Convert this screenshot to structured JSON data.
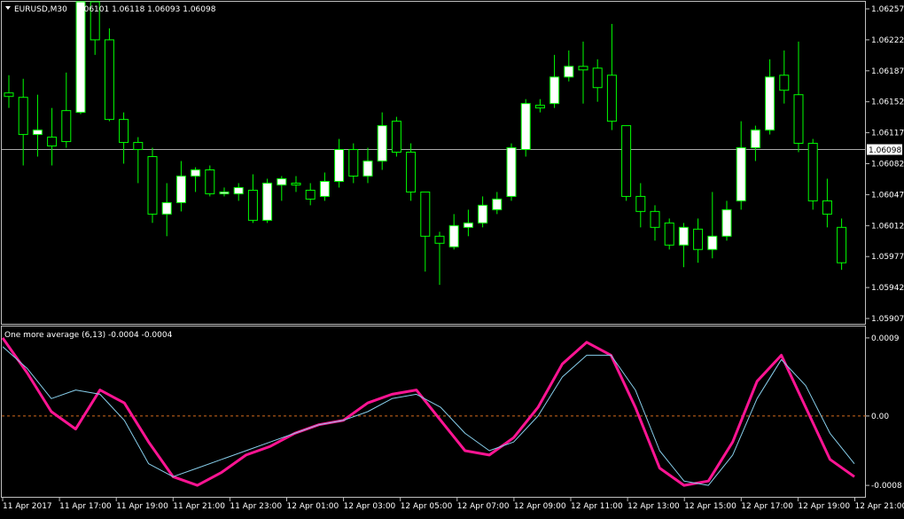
{
  "header": {
    "symbol": "EURUSD,M30",
    "ohlc": "1.06101 1.06118 1.06093 1.06098",
    "menu_glyph": "▼"
  },
  "indicator": {
    "title": "One more average (6,13) -0.0004 -0.0004",
    "y_ticks": [
      "0.0009",
      "0.00",
      "-0.0008"
    ],
    "zero_label": "0.00"
  },
  "price_axis": {
    "ticks": [
      "1.06257",
      "1.06222",
      "1.06187",
      "1.06152",
      "1.06117",
      "1.06082",
      "1.06047",
      "1.06012",
      "1.05977",
      "1.05942",
      "1.05907"
    ],
    "current_price": "1.06098"
  },
  "time_axis": {
    "labels": [
      "11 Apr 2017",
      "11 Apr 17:00",
      "11 Apr 19:00",
      "11 Apr 21:00",
      "11 Apr 23:00",
      "12 Apr 01:00",
      "12 Apr 03:00",
      "12 Apr 05:00",
      "12 Apr 07:00",
      "12 Apr 09:00",
      "12 Apr 11:00",
      "12 Apr 13:00",
      "12 Apr 15:00",
      "12 Apr 17:00",
      "12 Apr 19:00",
      "12 Apr 21:00"
    ]
  },
  "colors": {
    "background": "#000000",
    "bull_body": "#ffffff",
    "bear_body": "#000000",
    "wick": "#00ff00",
    "grid_frame": "#c0c0c0",
    "fast_line": "#ff1493",
    "slow_line": "#87ceeb",
    "zero_line": "#d2691e"
  },
  "chart_data": [
    {
      "type": "candlestick",
      "symbol": "EURUSD",
      "timeframe": "M30",
      "ylim": [
        1.05905,
        1.06265
      ],
      "candles": [
        {
          "o": 1.06162,
          "h": 1.06182,
          "l": 1.06145,
          "c": 1.06158
        },
        {
          "o": 1.06157,
          "h": 1.06178,
          "l": 1.0608,
          "c": 1.06115
        },
        {
          "o": 1.06115,
          "h": 1.0616,
          "l": 1.0609,
          "c": 1.0612
        },
        {
          "o": 1.06112,
          "h": 1.06145,
          "l": 1.0608,
          "c": 1.06102
        },
        {
          "o": 1.06142,
          "h": 1.06185,
          "l": 1.061,
          "c": 1.06107
        },
        {
          "o": 1.0614,
          "h": 1.06265,
          "l": 1.06138,
          "c": 1.06265
        },
        {
          "o": 1.06265,
          "h": 1.06265,
          "l": 1.06205,
          "c": 1.06222
        },
        {
          "o": 1.06222,
          "h": 1.06235,
          "l": 1.0613,
          "c": 1.06132
        },
        {
          "o": 1.06132,
          "h": 1.0614,
          "l": 1.06082,
          "c": 1.06106
        },
        {
          "o": 1.06106,
          "h": 1.06112,
          "l": 1.0606,
          "c": 1.06098
        },
        {
          "o": 1.0609,
          "h": 1.061,
          "l": 1.06015,
          "c": 1.06025
        },
        {
          "o": 1.06025,
          "h": 1.0606,
          "l": 1.06,
          "c": 1.06038
        },
        {
          "o": 1.06038,
          "h": 1.06085,
          "l": 1.06028,
          "c": 1.06068
        },
        {
          "o": 1.06068,
          "h": 1.06078,
          "l": 1.0605,
          "c": 1.06075
        },
        {
          "o": 1.06075,
          "h": 1.0608,
          "l": 1.06045,
          "c": 1.06048
        },
        {
          "o": 1.06048,
          "h": 1.06055,
          "l": 1.06045,
          "c": 1.0605
        },
        {
          "o": 1.06048,
          "h": 1.0606,
          "l": 1.0604,
          "c": 1.06055
        },
        {
          "o": 1.06052,
          "h": 1.0607,
          "l": 1.06015,
          "c": 1.06018
        },
        {
          "o": 1.06018,
          "h": 1.06065,
          "l": 1.06015,
          "c": 1.0606
        },
        {
          "o": 1.06058,
          "h": 1.06068,
          "l": 1.0604,
          "c": 1.06065
        },
        {
          "o": 1.0606,
          "h": 1.06068,
          "l": 1.0605,
          "c": 1.06058
        },
        {
          "o": 1.06052,
          "h": 1.0606,
          "l": 1.06035,
          "c": 1.06042
        },
        {
          "o": 1.06045,
          "h": 1.06072,
          "l": 1.0604,
          "c": 1.06062
        },
        {
          "o": 1.06062,
          "h": 1.0611,
          "l": 1.06055,
          "c": 1.06098
        },
        {
          "o": 1.06098,
          "h": 1.06105,
          "l": 1.0606,
          "c": 1.06068
        },
        {
          "o": 1.06068,
          "h": 1.061,
          "l": 1.0606,
          "c": 1.06085
        },
        {
          "o": 1.06085,
          "h": 1.0614,
          "l": 1.06075,
          "c": 1.06125
        },
        {
          "o": 1.0613,
          "h": 1.06135,
          "l": 1.0609,
          "c": 1.06095
        },
        {
          "o": 1.06095,
          "h": 1.06105,
          "l": 1.0604,
          "c": 1.0605
        },
        {
          "o": 1.0605,
          "h": 1.0605,
          "l": 1.0596,
          "c": 1.06
        },
        {
          "o": 1.06,
          "h": 1.06005,
          "l": 1.05945,
          "c": 1.05992
        },
        {
          "o": 1.05988,
          "h": 1.06025,
          "l": 1.05985,
          "c": 1.06012
        },
        {
          "o": 1.0601,
          "h": 1.0603,
          "l": 1.06,
          "c": 1.06015
        },
        {
          "o": 1.06015,
          "h": 1.06045,
          "l": 1.0601,
          "c": 1.06035
        },
        {
          "o": 1.0603,
          "h": 1.0605,
          "l": 1.06025,
          "c": 1.06042
        },
        {
          "o": 1.06045,
          "h": 1.06105,
          "l": 1.0604,
          "c": 1.061
        },
        {
          "o": 1.06098,
          "h": 1.06155,
          "l": 1.0609,
          "c": 1.0615
        },
        {
          "o": 1.06148,
          "h": 1.06155,
          "l": 1.0614,
          "c": 1.06145
        },
        {
          "o": 1.0615,
          "h": 1.06205,
          "l": 1.06145,
          "c": 1.0618
        },
        {
          "o": 1.0618,
          "h": 1.0621,
          "l": 1.06175,
          "c": 1.06192
        },
        {
          "o": 1.06192,
          "h": 1.0622,
          "l": 1.0615,
          "c": 1.06188
        },
        {
          "o": 1.0619,
          "h": 1.062,
          "l": 1.06152,
          "c": 1.06168
        },
        {
          "o": 1.06182,
          "h": 1.0624,
          "l": 1.0612,
          "c": 1.0613
        },
        {
          "o": 1.06125,
          "h": 1.06125,
          "l": 1.0604,
          "c": 1.06045
        },
        {
          "o": 1.06045,
          "h": 1.0606,
          "l": 1.0601,
          "c": 1.06028
        },
        {
          "o": 1.06028,
          "h": 1.06035,
          "l": 1.05995,
          "c": 1.0601
        },
        {
          "o": 1.06015,
          "h": 1.0602,
          "l": 1.05985,
          "c": 1.0599
        },
        {
          "o": 1.0599,
          "h": 1.06015,
          "l": 1.05965,
          "c": 1.0601
        },
        {
          "o": 1.06008,
          "h": 1.0602,
          "l": 1.0597,
          "c": 1.05985
        },
        {
          "o": 1.05985,
          "h": 1.0605,
          "l": 1.05975,
          "c": 1.06
        },
        {
          "o": 1.06,
          "h": 1.0604,
          "l": 1.05995,
          "c": 1.0603
        },
        {
          "o": 1.0604,
          "h": 1.0613,
          "l": 1.0603,
          "c": 1.061
        },
        {
          "o": 1.061,
          "h": 1.06125,
          "l": 1.06085,
          "c": 1.0612
        },
        {
          "o": 1.0612,
          "h": 1.062,
          "l": 1.06115,
          "c": 1.0618
        },
        {
          "o": 1.06182,
          "h": 1.0621,
          "l": 1.0615,
          "c": 1.06165
        },
        {
          "o": 1.0616,
          "h": 1.0622,
          "l": 1.06095,
          "c": 1.06105
        },
        {
          "o": 1.06105,
          "h": 1.0611,
          "l": 1.0603,
          "c": 1.0604
        },
        {
          "o": 1.0604,
          "h": 1.06065,
          "l": 1.0601,
          "c": 1.06025
        },
        {
          "o": 1.0601,
          "h": 1.0602,
          "l": 1.05962,
          "c": 1.0597
        }
      ]
    },
    {
      "type": "line",
      "title": "One more average (6,13)",
      "ylim": [
        -0.00085,
        0.00095
      ],
      "series": [
        {
          "name": "fast",
          "color": "#ff1493",
          "values": [
            0.0009,
            0.0005,
            5e-05,
            -0.00015,
            0.0003,
            0.00015,
            -0.0003,
            -0.0007,
            -0.0008,
            -0.00065,
            -0.00045,
            -0.00035,
            -0.0002,
            -0.0001,
            -5e-05,
            0.00015,
            0.00025,
            0.0003,
            -5e-05,
            -0.0004,
            -0.00045,
            -0.00025,
            0.0001,
            0.0006,
            0.00085,
            0.0007,
            0.0001,
            -0.0006,
            -0.0008,
            -0.00075,
            -0.0003,
            0.0004,
            0.0007,
            0.0001,
            -0.0005,
            -0.0007
          ]
        },
        {
          "name": "slow",
          "color": "#87ceeb",
          "values": [
            0.0008,
            0.00055,
            0.0002,
            0.0003,
            0.00025,
            -5e-05,
            -0.00055,
            -0.0007,
            -0.0006,
            -0.0005,
            -0.0004,
            -0.0003,
            -0.0002,
            -0.0001,
            -5e-05,
            5e-05,
            0.0002,
            0.00025,
            0.0001,
            -0.0002,
            -0.0004,
            -0.0003,
            0.0,
            0.00045,
            0.0007,
            0.0007,
            0.0003,
            -0.0004,
            -0.00075,
            -0.0008,
            -0.00045,
            0.0002,
            0.00065,
            0.00035,
            -0.0002,
            -0.00055
          ]
        }
      ]
    }
  ]
}
